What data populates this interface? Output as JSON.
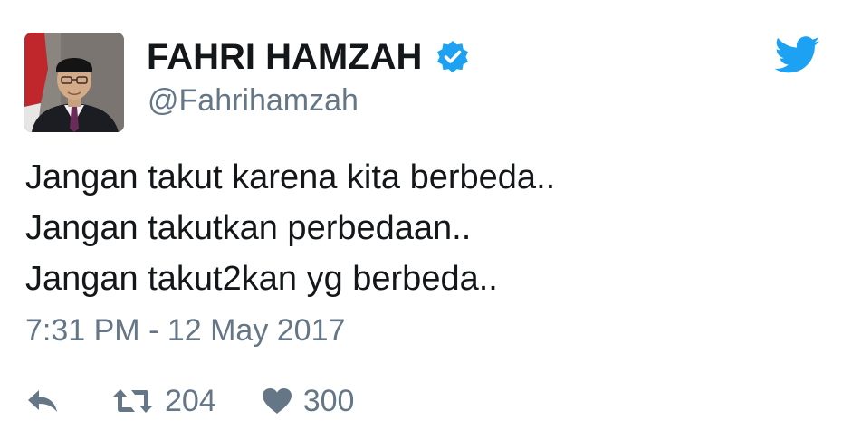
{
  "user": {
    "display_name": "FAHRI HAMZAH",
    "handle": "@Fahrihamzah",
    "verified": true,
    "avatar_icon": "profile-photo"
  },
  "brand": {
    "icon": "twitter-bird-icon",
    "color": "#1da1f2"
  },
  "tweet": {
    "lines": [
      "Jangan takut karena kita berbeda..",
      "Jangan takutkan perbedaan..",
      "Jangan takut2kan yg berbeda.."
    ],
    "timestamp": "7:31 PM - 12 May 2017"
  },
  "actions": {
    "reply_icon": "reply-icon",
    "retweet_icon": "retweet-icon",
    "retweet_count": "204",
    "like_icon": "heart-icon",
    "like_count": "300"
  },
  "colors": {
    "text": "#14171a",
    "secondary": "#657786",
    "verified": "#1da1f2"
  }
}
